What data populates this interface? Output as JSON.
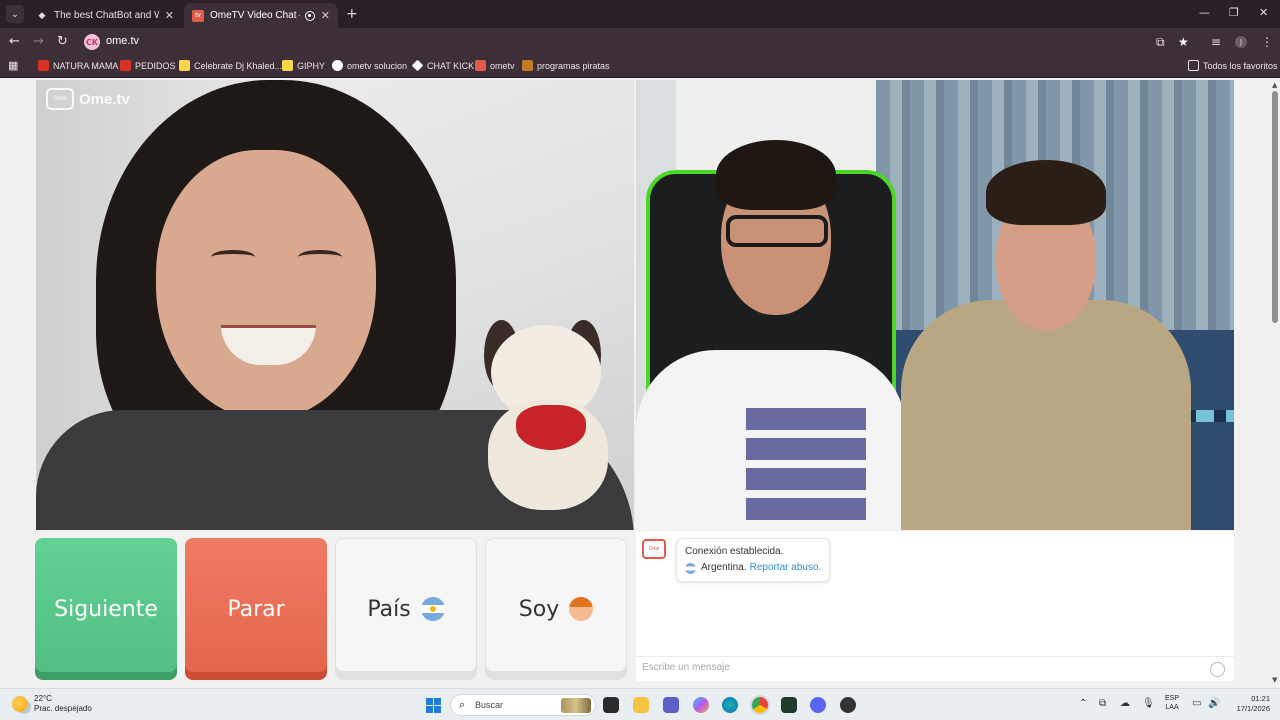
{
  "browser": {
    "tabs": [
      {
        "title": "The best ChatBot and Widgets",
        "active": false,
        "icon": "diamond-icon"
      },
      {
        "title": "OmeTV Video Chat — Ome",
        "active": true,
        "icon": "ometv-icon"
      }
    ],
    "url": "ome.tv",
    "site_badge": "CK",
    "bookmarks": [
      {
        "label": "NATURA MAMA",
        "icon": "pdf-icon",
        "color": "#d93025"
      },
      {
        "label": "PEDIDOS",
        "icon": "pdf-icon",
        "color": "#d93025"
      },
      {
        "label": "Celebrate Dj Khaled...",
        "icon": "page-icon",
        "color": "#ffd54a"
      },
      {
        "label": "GIPHY",
        "icon": "page-icon",
        "color": "#ffd54a"
      },
      {
        "label": "ometv solucion",
        "icon": "google-icon",
        "color": "#ffffff"
      },
      {
        "label": "CHAT KICK",
        "icon": "diamond-icon",
        "color": "#ffffff"
      },
      {
        "label": "ometv",
        "icon": "ometv-icon",
        "color": "#e15b4a"
      },
      {
        "label": "programas piratas",
        "icon": "ap-icon",
        "color": "#c57a2a"
      }
    ],
    "all_bookmarks": "Todos los favoritos"
  },
  "app": {
    "logo_top": "Ome",
    "logo_bottom": "TV",
    "logo_text": "Ome.tv",
    "buttons": {
      "next": "Siguiente",
      "stop": "Parar",
      "country": "País",
      "gender": "Soy"
    },
    "colors": {
      "next": "#5cc98d",
      "stop": "#e96a51",
      "link": "#2d8fd5"
    },
    "chat": {
      "status": "Conexión establecida.",
      "country": "Argentina.",
      "report_link": "Reportar abuso.",
      "input_placeholder": "Escribe un mensaje"
    }
  },
  "taskbar": {
    "temperature": "22°C",
    "weather": "Prac. despejado",
    "search_label": "Buscar",
    "lang_top": "ESP",
    "lang_bottom": "LAA",
    "time": "01:21",
    "date": "17/1/2026"
  }
}
